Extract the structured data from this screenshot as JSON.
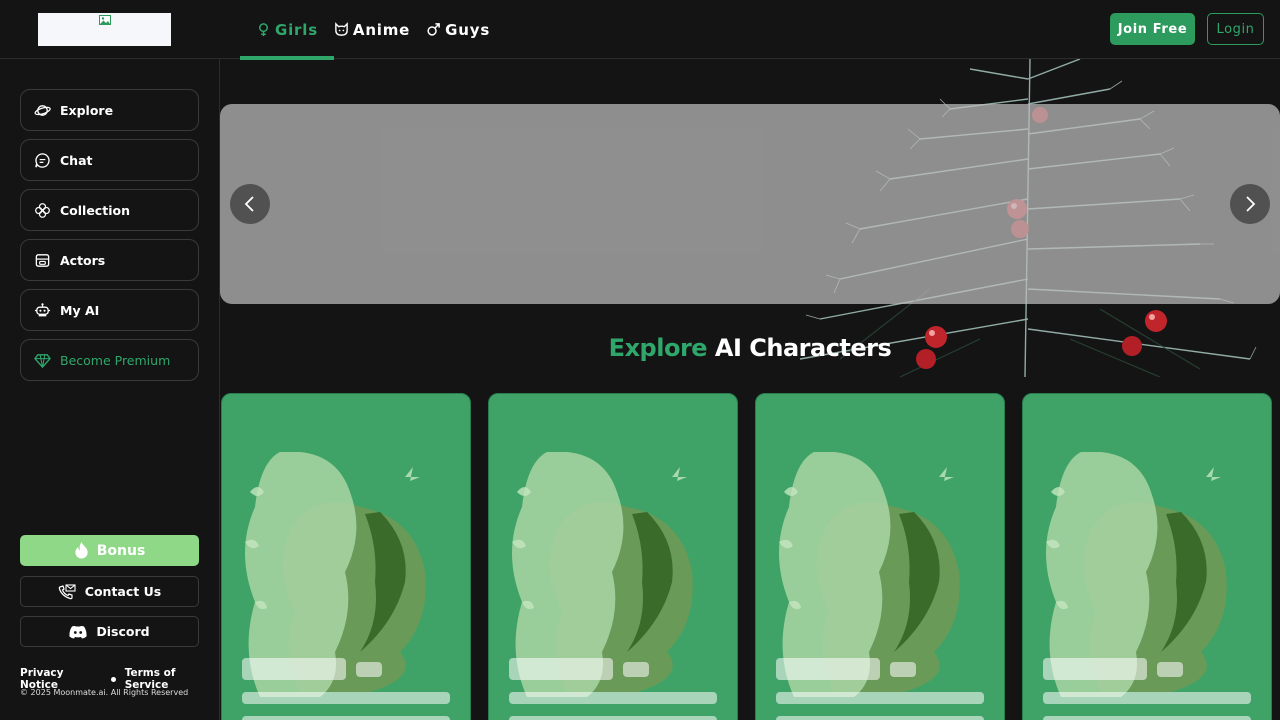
{
  "header": {
    "tabs": [
      {
        "label": "Girls",
        "icon": "female-icon",
        "active": true
      },
      {
        "label": "Anime",
        "icon": "cat-face-icon",
        "active": false
      },
      {
        "label": "Guys",
        "icon": "male-icon",
        "active": false
      }
    ],
    "join_label": "Join Free",
    "login_label": "Login"
  },
  "sidebar": {
    "items": [
      {
        "label": "Explore",
        "icon": "planet-icon"
      },
      {
        "label": "Chat",
        "icon": "chat-bubble-icon"
      },
      {
        "label": "Collection",
        "icon": "clover-icon"
      },
      {
        "label": "Actors",
        "icon": "robot-box-icon"
      },
      {
        "label": "My AI",
        "icon": "robot-icon"
      },
      {
        "label": "Become Premium",
        "icon": "diamond-icon"
      }
    ],
    "bonus_label": "Bonus",
    "contact_label": "Contact Us",
    "discord_label": "Discord",
    "privacy_label": "Privacy Notice",
    "terms_label": "Terms of Service",
    "copyright": "© 2025 Moonmate.ai. All Rights Reserved"
  },
  "main": {
    "title_highlight": "Explore",
    "title_rest": " AI Characters"
  },
  "colors": {
    "accent": "#2fa76b",
    "card_bg": "#3fa367",
    "bonus_bg": "#8fd888",
    "background": "#141414"
  }
}
